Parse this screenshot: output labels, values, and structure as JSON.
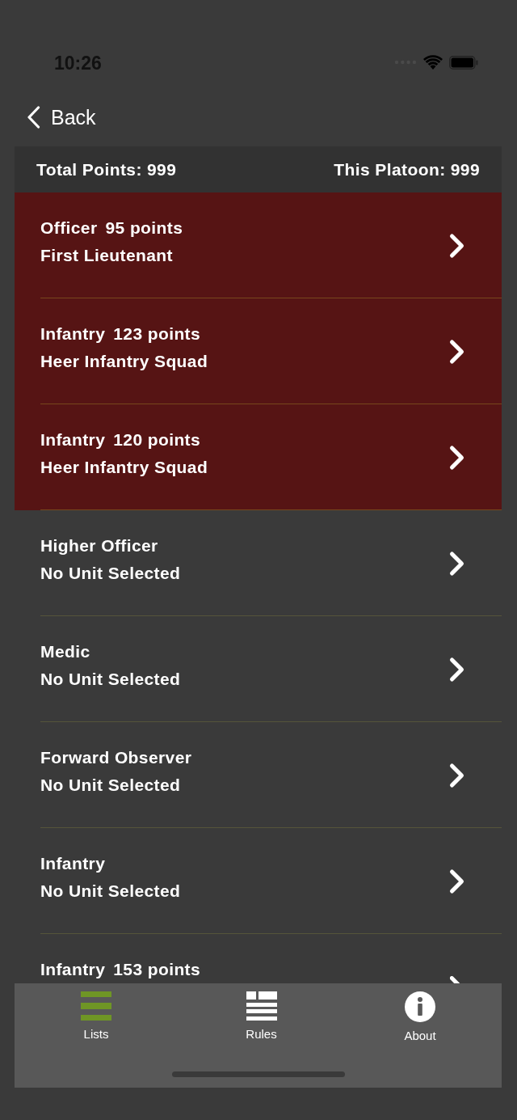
{
  "status_bar": {
    "time": "10:26"
  },
  "nav": {
    "back": "Back"
  },
  "summary": {
    "total": "Total Points: 999",
    "platoon": "This Platoon: 999"
  },
  "slots": [
    {
      "role": "Officer",
      "points": "95 points",
      "unit": "First Lieutenant",
      "highlighted": true
    },
    {
      "role": "Infantry",
      "points": "123 points",
      "unit": "Heer Infantry Squad",
      "highlighted": true
    },
    {
      "role": "Infantry",
      "points": "120 points",
      "unit": "Heer Infantry Squad",
      "highlighted": true
    },
    {
      "role": "Higher Officer",
      "unit": "No Unit Selected",
      "highlighted": false
    },
    {
      "role": "Medic",
      "unit": "No Unit Selected",
      "highlighted": false
    },
    {
      "role": "Forward Observer",
      "unit": "No Unit Selected",
      "highlighted": false
    },
    {
      "role": "Infantry",
      "unit": "No Unit Selected",
      "highlighted": false
    },
    {
      "role": "Infantry",
      "points": "153 points",
      "highlighted": false
    }
  ],
  "tab_bar": [
    {
      "label": "Lists",
      "selected": true
    },
    {
      "label": "Rules",
      "selected": false
    },
    {
      "label": "About",
      "selected": false
    }
  ]
}
